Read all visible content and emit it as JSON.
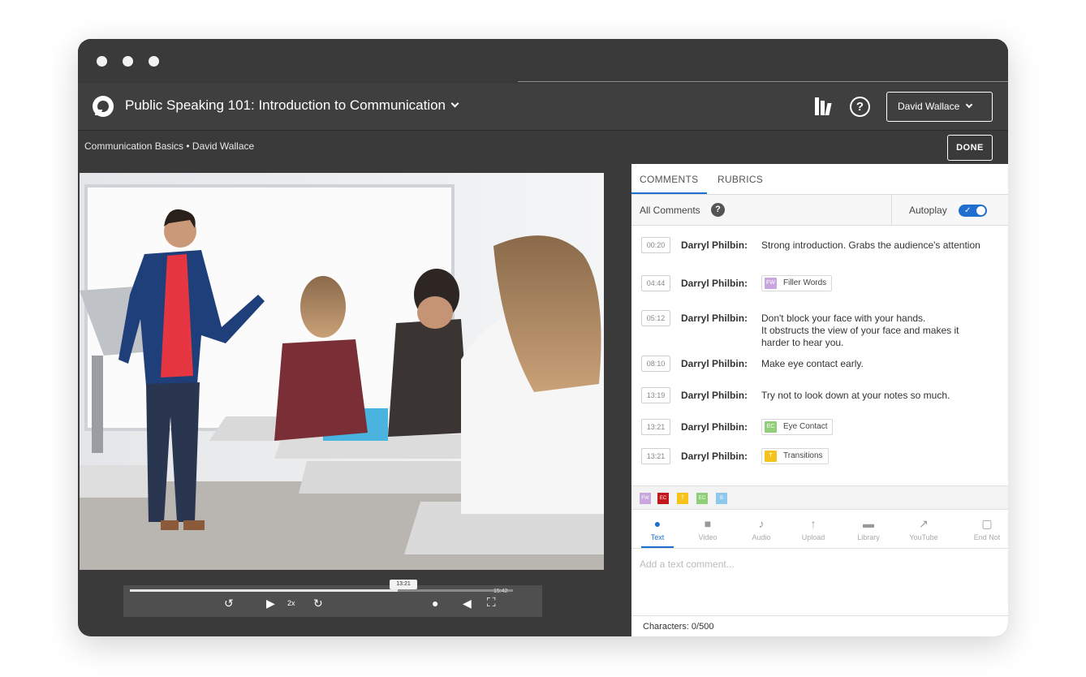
{
  "app": {
    "course_title": "Public Speaking 101: Introduction to Communication",
    "user_name": "David Wallace",
    "breadcrumb": "Communication Basics • David Wallace",
    "done_label": "DONE"
  },
  "panel": {
    "tabs": [
      {
        "label": "COMMENTS",
        "active": true
      },
      {
        "label": "RUBRICS",
        "active": false
      }
    ],
    "all_comments_label": "All Comments",
    "help_glyph": "?",
    "autoplay_label": "Autoplay",
    "autoplay_on": true,
    "comments": [
      {
        "time": "00:20",
        "author": "Darryl Philbin:",
        "text": "Strong introduction. Grabs the audience's attention"
      },
      {
        "time": "04:44",
        "author": "Darryl Philbin:",
        "tag": {
          "abbr": "FW",
          "label": "Filler Words",
          "color": "#c9a7de"
        }
      },
      {
        "time": "05:12",
        "author": "Darryl Philbin:",
        "text_lines": [
          "Don't block your face with your hands.",
          "It obstructs the view of your face and makes it",
          "harder to hear you."
        ]
      },
      {
        "time": "08:10",
        "author": "Darryl Philbin:",
        "text": "Make eye contact early."
      },
      {
        "time": "13:19",
        "author": "Darryl Philbin:",
        "text": "Try not to look down at your notes so much."
      },
      {
        "time": "13:21",
        "author": "Darryl Philbin:",
        "tag": {
          "abbr": "EC",
          "label": "Eye Contact",
          "color": "#8fcf7a"
        }
      },
      {
        "time": "13:21",
        "author": "Darryl Philbin:",
        "tag": {
          "abbr": "T",
          "label": "Transitions",
          "color": "#f5c31c"
        }
      }
    ],
    "tag_palette": [
      {
        "abbr": "FW",
        "color": "#c9a7de"
      },
      {
        "abbr": "EC",
        "color": "#c4161c"
      },
      {
        "abbr": "T",
        "color": "#f5c31c"
      },
      {
        "abbr": "EC",
        "color": "#8fcf7a"
      },
      {
        "abbr": "B",
        "color": "#8ec8ea"
      }
    ],
    "tools": [
      {
        "label": "Text",
        "icon": "speech-bubble-icon",
        "active": true
      },
      {
        "label": "Video",
        "icon": "video-camera-icon",
        "active": false
      },
      {
        "label": "Audio",
        "icon": "microphone-icon",
        "active": false
      },
      {
        "label": "Upload",
        "icon": "upload-arrow-icon",
        "active": false
      },
      {
        "label": "Library",
        "icon": "folder-icon",
        "active": false
      },
      {
        "label": "YouTube",
        "icon": "external-link-icon",
        "active": false
      },
      {
        "label": "End Not",
        "icon": "note-icon",
        "active": false
      }
    ],
    "comment_placeholder": "Add a text comment...",
    "char_count": "Characters: 0/500"
  },
  "player": {
    "current_time": "13:21",
    "duration": "15:42",
    "progress": 0.7,
    "speed_label": "2x"
  },
  "colors": {
    "accent": "#1f6fd1",
    "chrome": "#3a3a3a"
  }
}
